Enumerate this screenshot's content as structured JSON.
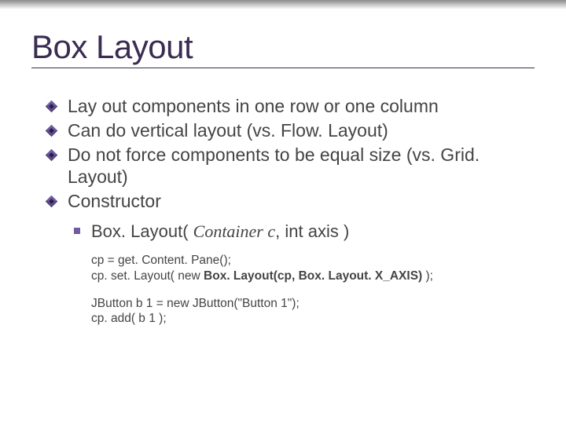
{
  "title": "Box Layout",
  "bullets": {
    "b1": "Lay out components in one row or one column",
    "b2": "Can do vertical layout (vs. Flow. Layout)",
    "b3": "Do not force components to be equal size (vs. Grid. Layout)",
    "b4": "Constructor"
  },
  "sub": {
    "s1_prefix": "Box. Layout( ",
    "s1_italic": "Container c",
    "s1_suffix": ", int axis )"
  },
  "code": {
    "l1": "cp = get. Content. Pane();",
    "l2a": "cp. set. Layout( new ",
    "l2b": "Box. Layout(cp, Box. Layout. X_AXIS)",
    "l2c": " );",
    "l3": "JButton b 1 = new JButton(\"Button 1\");",
    "l4": "cp. add( b 1 );"
  }
}
